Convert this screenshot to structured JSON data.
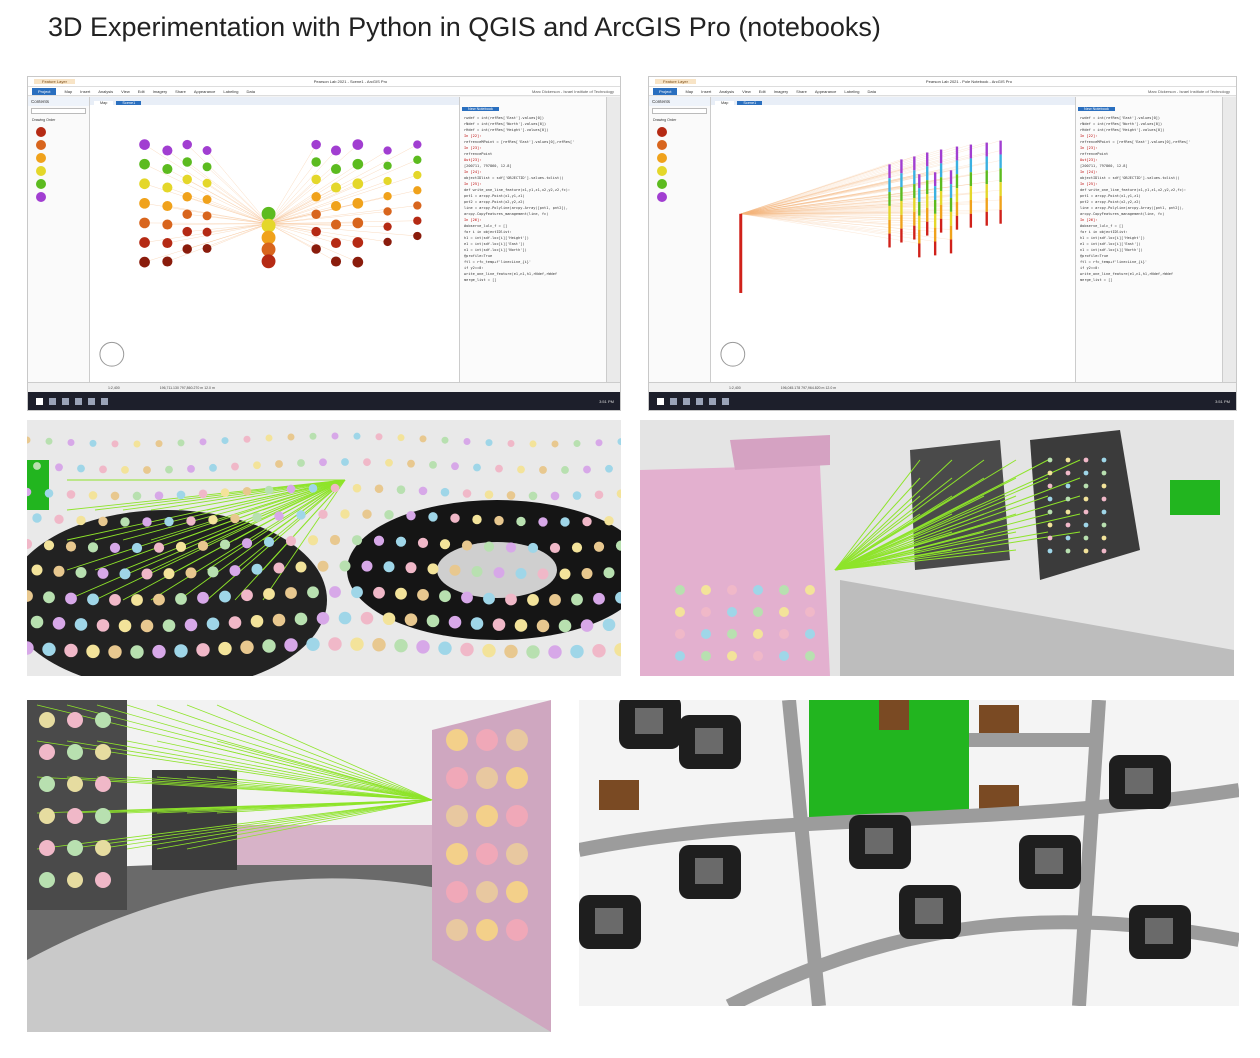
{
  "page": {
    "title": "3D Experimentation with Python in QGIS and ArcGIS Pro (notebooks)"
  },
  "screens": [
    {
      "window_title": "Pearson Lab 2021 - Scene1 - ArcGIS Pro",
      "highlight_tab": "Feature Layer",
      "project_tab": "Project",
      "ribbon": [
        "Map",
        "Insert",
        "Analysis",
        "View",
        "Edit",
        "Imagery",
        "Share",
        "Appearance",
        "Labeling",
        "Data"
      ],
      "user": "Marc Dickerson - Israel Institute of Technology",
      "contents_title": "Contents",
      "drawing_order": "Drawing Order",
      "map_tabs": [
        "Map",
        "Scene1"
      ],
      "notebook_tab": "New Notebook",
      "code": [
        "rwdef = int(refRes['East'].values[0])",
        "rNdef = int(refRes['North'].values[0])",
        "rHdef = int(refRes['Height'].values[0])",
        "In [22]:",
        "refrenceMPoint = [refRes['East'].values[0],refRes['",
        "In [23]:",
        "refrencePoint",
        "Out[23]:",
        "[200711, 797860, 12.8]",
        "In [24]:",
        "objectIDlist = sdf['OBJECTID'].values.tolist()",
        "In [25]:",
        "def write_one_line_feature(x1,y1,z1,x2,y2,z2,fc):",
        "    pnt1 = arcpy.Point(x1,y1,z1)",
        "    pnt2 = arcpy.Point(x2,y2,z2)",
        "    line = arcpy.Polyline(arcpy.Array([pnt1, pnt2]),",
        "    arcpy.CopyFeatures_management(line, fc)",
        "In [26]:",
        "#observe_lulc_f = []",
        "for i in objectIDlist:",
        "    h1 = int(sdf.loc[i]['Height'])",
        "    e1 = int(sdf.loc[i]['East'])",
        "    n1 = int(sdf.loc[i]['North'])",
        "    @profile=True",
        "    ftl = rfc_temp+f'linecLine_{i}'",
        "    if y2==0:",
        "        write_one_line_feature(e1,n1,h1,rNdef,rWdef",
        "    merge_list = []"
      ],
      "scale": "1:2,400",
      "coords": "196,711.130 797,860.270 m  12.0 m",
      "time": "3:51 PM"
    },
    {
      "window_title": "Pearson Lab 2021 - Pole Notebook - ArcGIS Pro",
      "highlight_tab": "Feature Layer",
      "project_tab": "Project",
      "ribbon": [
        "Map",
        "Insert",
        "Analysis",
        "View",
        "Edit",
        "Imagery",
        "Share",
        "Appearance",
        "Labeling",
        "Data"
      ],
      "user": "Marc Dickerson - Israel Institute of Technology",
      "contents_title": "Contents",
      "drawing_order": "Drawing Order",
      "map_tabs": [
        "Map",
        "Scene1"
      ],
      "notebook_tab": "New Notebook",
      "code": [
        "rwdef = int(refRes['East'].values[0])",
        "rNdef = int(refRes['North'].values[0])",
        "rHdef = int(refRes['Height'].values[0])",
        "In [22]:",
        "refrenceMPoint = [refRes['East'].values[0],refRes['",
        "In [23]:",
        "refrencePoint",
        "Out[23]:",
        "[200711, 797860, 12.8]",
        "In [24]:",
        "objectIDlist = sdf['OBJECTID'].values.tolist()",
        "In [25]:",
        "def write_one_line_feature(x1,y1,z1,x2,y2,z2,fc):",
        "    pnt1 = arcpy.Point(x1,y1,z1)",
        "    pnt2 = arcpy.Point(x2,y2,z2)",
        "    line = arcpy.Polyline(arcpy.Array([pnt1, pnt2]),",
        "    arcpy.CopyFeatures_management(line, fc)",
        "In [26]:",
        "#observe_lulc_f = []",
        "for i in objectIDlist:",
        "    h1 = int(sdf.loc[i]['Height'])",
        "    e1 = int(sdf.loc[i]['East'])",
        "    n1 = int(sdf.loc[i]['North'])",
        "    @profile=True",
        "    ftl = rfc_temp+f'linecLine_{i}'",
        "    if y2==0:",
        "        write_one_line_feature(e1,n1,h1,rNdef,rWdef",
        "    merge_list = []"
      ],
      "scale": "1:2,400",
      "coords": "196,045.178 797,964.820 m  12.0 m",
      "time": "3:51 PM"
    }
  ],
  "colors": {
    "sight_line_green": "#8ee42a",
    "sight_line_orange": "#f3b37a",
    "building_pink": "#e3b0cf",
    "building_dark": "#3b3b3b",
    "park_green": "#22b51f",
    "roof_brown": "#7a4a23",
    "road_gray": "#9c9c9c",
    "ribbon_blue": "#2a6fbf"
  }
}
